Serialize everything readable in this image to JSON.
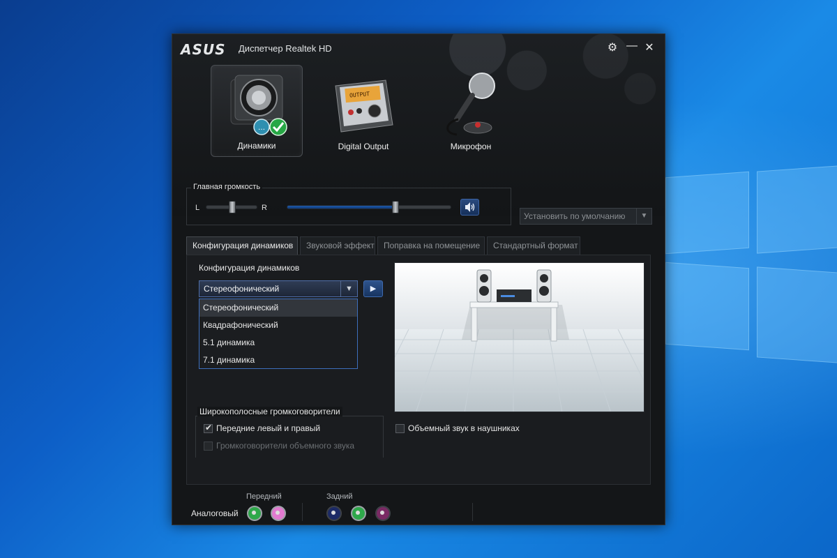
{
  "window": {
    "logo": "ASUS",
    "title": "Диспетчер Realtek HD"
  },
  "devices": [
    {
      "label": "Динамики",
      "icon": "speaker-icon",
      "active": true
    },
    {
      "label": "Digital Output",
      "icon": "digital-output-icon",
      "active": false
    },
    {
      "label": "Микрофон",
      "icon": "microphone-icon",
      "active": false
    }
  ],
  "volume": {
    "group_title": "Главная громкость",
    "balance_left": "L",
    "balance_right": "R",
    "balance_value": 0.5,
    "level_value": 0.66
  },
  "default_select": {
    "label": "Установить по умолчанию"
  },
  "tabs": [
    {
      "label": "Конфигурация динамиков",
      "active": true
    },
    {
      "label": "Звуковой эффект",
      "active": false
    },
    {
      "label": "Поправка на помещение",
      "active": false
    },
    {
      "label": "Стандартный формат",
      "active": false
    }
  ],
  "speaker_config": {
    "heading": "Конфигурация динамиков",
    "selected": "Стереофонический",
    "options": [
      "Стереофонический",
      "Квадрафонический",
      "5.1 динамика",
      "7.1 динамика"
    ]
  },
  "fullrange": {
    "title": "Широкополосные громкоговорители",
    "front": {
      "label": "Передние левый и правый",
      "checked": true
    },
    "surround": {
      "label": "Громкоговорители объемного звука",
      "checked": false,
      "disabled": true
    }
  },
  "headphones_virtualization": {
    "label": "Объемный звук в наушниках",
    "checked": false
  },
  "jacks": {
    "row_label": "Аналоговый",
    "front_label": "Передний",
    "rear_label": "Задний",
    "front": [
      {
        "color": "#2ea84a"
      },
      {
        "color": "#e27ad0"
      }
    ],
    "rear": [
      {
        "color": "#1c2a66"
      },
      {
        "color": "#2ea84a"
      },
      {
        "color": "#7a2a64"
      }
    ]
  },
  "colors": {
    "accent": "#3e6fbd",
    "window_bg": "#141618"
  }
}
